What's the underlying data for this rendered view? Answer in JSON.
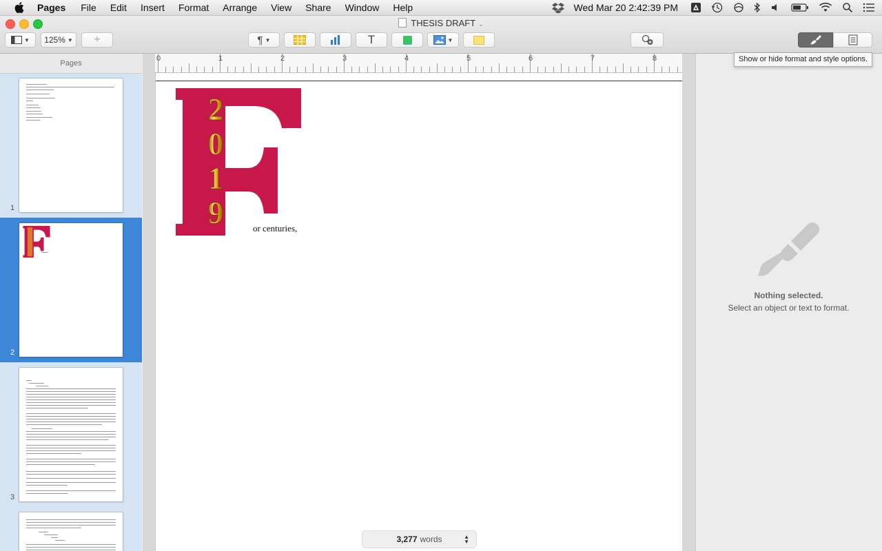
{
  "menubar": {
    "app": "Pages",
    "items": [
      "File",
      "Edit",
      "Insert",
      "Format",
      "Arrange",
      "View",
      "Share",
      "Window",
      "Help"
    ],
    "clock": "Wed Mar 20  2:42:39 PM"
  },
  "window": {
    "title": "THESIS DRAFT",
    "zoom": "125%"
  },
  "sidebar": {
    "header": "Pages",
    "pages": [
      "1",
      "2",
      "3"
    ],
    "selected_page": "2"
  },
  "ruler": {
    "marks": [
      "0",
      "1",
      "2",
      "3",
      "4",
      "5",
      "6",
      "7",
      "8"
    ]
  },
  "document": {
    "dropcap_letter": "F",
    "dropcap_year_digits": [
      "2",
      "0",
      "1",
      "9"
    ],
    "body_text": "or centuries,",
    "accent_color": "#c8174b",
    "gold_color": "#e0a21e"
  },
  "status": {
    "word_count": "3,277",
    "word_label": "words"
  },
  "inspector": {
    "tooltip": "Show or hide format and style options.",
    "empty_title": "Nothing selected.",
    "empty_subtitle": "Select an object or text to format."
  }
}
